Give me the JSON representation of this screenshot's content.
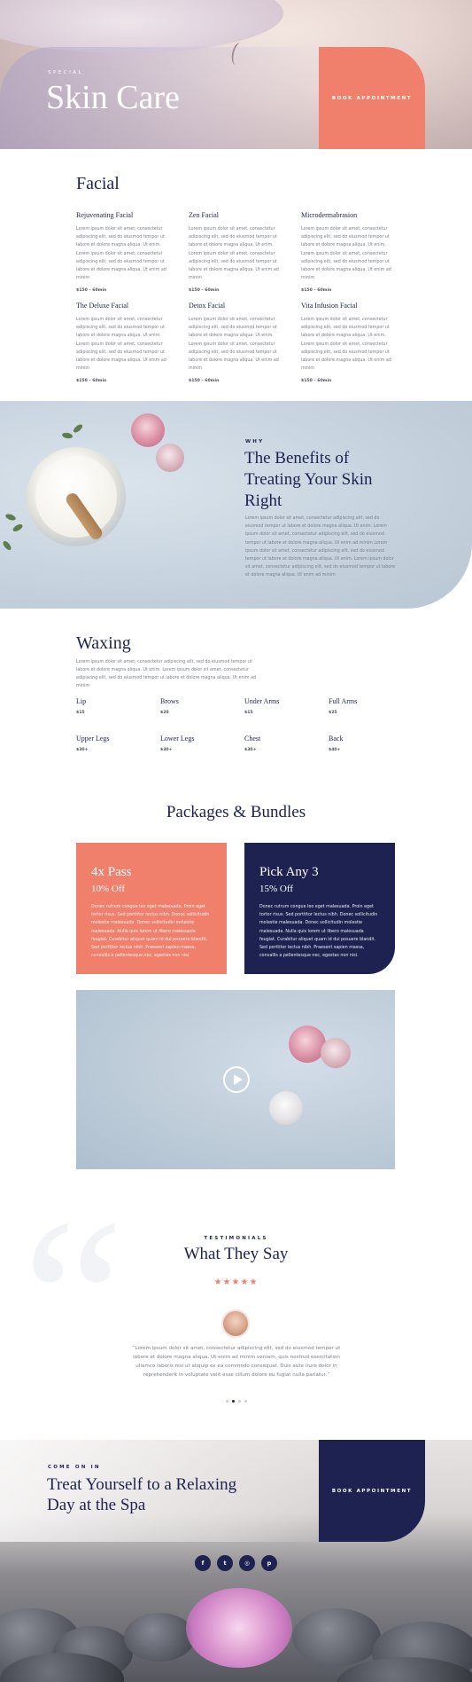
{
  "colors": {
    "navy": "#1d2250",
    "coral": "#f07f6c",
    "text": "#7b7f8a"
  },
  "hero": {
    "eyebrow": "SPECIAL",
    "title": "Skin Care",
    "cta": "BOOK APPOINTMENT"
  },
  "facial": {
    "title": "Facial",
    "services": [
      {
        "name": "Rejuvenating Facial",
        "desc": "Lorem ipsum dolor sit amet, consectetur adipiscing elit, sed do eiusmod tempor ut labore et dolore magna aliqua. Ut enim. Lorem ipsum dolor sit amet, consectetur adipiscing elit, sed do eiusmod tempor ut labore et dolore magna aliqua. Ut enim ad minim",
        "price": "$150 – 60min"
      },
      {
        "name": "Zen Facial",
        "desc": "Lorem ipsum dolor sit amet, consectetur adipiscing elit, sed do eiusmod tempor ut labore et dolore magna aliqua. Ut enim. Lorem ipsum dolor sit amet, consectetur adipiscing elit, sed do eiusmod tempor ut labore et dolore magna aliqua. Ut enim ad minim",
        "price": "$150 – 60min"
      },
      {
        "name": "Microdermabrasion",
        "desc": "Lorem ipsum dolor sit amet, consectetur adipiscing elit, sed do eiusmod tempor ut labore et dolore magna aliqua. Ut enim. Lorem ipsum dolor sit amet, consectetur adipiscing elit, sed do eiusmod tempor ut labore et dolore magna aliqua. Ut enim ad minim",
        "price": "$150 – 60min"
      },
      {
        "name": "The Deluxe Facial",
        "desc": "Lorem ipsum dolor sit amet, consectetur adipiscing elit, sed do eiusmod tempor ut labore et dolore magna aliqua. Ut enim. Lorem ipsum dolor sit amet, consectetur adipiscing elit, sed do eiusmod tempor ut labore et dolore magna aliqua. Ut enim ad minim",
        "price": "$150 – 60min"
      },
      {
        "name": "Detox Facial",
        "desc": "Lorem ipsum dolor sit amet, consectetur adipiscing elit, sed do eiusmod tempor ut labore et dolore magna aliqua. Ut enim. Lorem ipsum dolor sit amet, consectetur adipiscing elit, sed do eiusmod tempor ut labore et dolore magna aliqua. Ut enim ad minim",
        "price": "$150 – 60min"
      },
      {
        "name": "Vita Infusion Facial",
        "desc": "Lorem ipsum dolor sit amet, consectetur adipiscing elit, sed do eiusmod tempor ut labore et dolore magna aliqua. Ut enim. Lorem ipsum dolor sit amet, consectetur adipiscing elit, sed do eiusmod tempor ut labore et dolore magna aliqua. Ut enim ad minim",
        "price": "$150 – 60min"
      }
    ]
  },
  "benefits": {
    "eyebrow": "WHY",
    "title": "The Benefits of Treating Your Skin Right",
    "text": "Lorem ipsum dolor sit amet, consectetur adipiscing elit, sed do eiusmod tempor ut labore et dolore magna aliqua. Ut enim. Lorem ipsum dolor sit amet, consectetur adipiscing elit, sed do eiusmod tempor ut labore et dolore magna aliqua. Ut enim ad minim Lorem ipsum dolor sit amet, consectetur adipiscing elit, sed do eiusmod tempor ut labore et dolore magna aliqua. Ut enim. Lorem ipsum dolor sit amet, consectetur adipiscing elit, sed do eiusmod tempor ut labore et dolore magna aliqua. Ut enim ad minim"
  },
  "waxing": {
    "title": "Waxing",
    "desc": "Lorem ipsum dolor sit amet, consectetur adipiscing elit, sed do eiusmod tempor ut labore et dolore magna aliqua. Ut enim. Lorem ipsum dolor sit amet, consectetur adipiscing elit, sed do eiusmod tempor ut labore et dolore magna aliqua. Ut enim ad minim",
    "items": [
      {
        "name": "Lip",
        "price": "$15"
      },
      {
        "name": "Brows",
        "price": "$20"
      },
      {
        "name": "Under Arms",
        "price": "$15"
      },
      {
        "name": "Full Arms",
        "price": "$25"
      },
      {
        "name": "Upper Legs",
        "price": "$30+"
      },
      {
        "name": "Lower Legs",
        "price": "$30+"
      },
      {
        "name": "Chest",
        "price": "$30+"
      },
      {
        "name": "Back",
        "price": "$40+"
      }
    ]
  },
  "packages": {
    "title": "Packages & Bundles",
    "items": [
      {
        "name": "4x Pass",
        "discount": "10% Off",
        "desc": "Donec rutrum congue leo eget malesuada. Proin eget tortor risus. Sed porttitor lectus nibh. Donec sollicitudin molestie malesuada. Donec sollicitudin molestie malesuada. Nulla quis lorem ut libero malesuada feugiat. Curabitur aliquet quam id dui posuere blandit. Sed porttitor lectus nibh. Praesent sapien massa, convallis a pellentesque nec, egestas non nisi."
      },
      {
        "name": "Pick Any 3",
        "discount": "15% Off",
        "desc": "Donec rutrum congue leo eget malesuada. Proin eget tortor risus. Sed porttitor lectus nibh. Donec sollicitudin molestie malesuada. Donec sollicitudin molestie malesuada. Nulla quis lorem ut libero malesuada feugiat. Curabitur aliquet quam id dui posuere blandit. Sed porttitor lectus nibh. Praesent sapien massa, convallis a pellentesque nec, egestas non nisi."
      }
    ]
  },
  "video": {
    "play_icon": "play-icon"
  },
  "testimonials": {
    "eyebrow": "TESTIMONIALS",
    "title": "What They Say",
    "stars": "★★★★★",
    "rating": 5,
    "quote": "“Lorem ipsum dolor sit amet, consectetur adipiscing elit, sed do eiusmod tempor ut labore et dolore magna aliqua. Ut enim ad minim veniam, quis nostrud exercitation ullamco laboris nisi ut aliquip ex ea commodo consequat. Duis aute irure dolor in reprehenderit in voluptate velit esse cillum dolore eu fugiat nulla pariatur.”",
    "dots": 4,
    "active_dot": 2
  },
  "cta": {
    "eyebrow": "COME ON IN",
    "title": "Treat Yourself to a Relaxing Day at the Spa",
    "button": "BOOK APPOINTMENT"
  },
  "socials": [
    {
      "icon": "facebook-icon",
      "glyph": "f"
    },
    {
      "icon": "twitter-icon",
      "glyph": "t"
    },
    {
      "icon": "instagram-icon",
      "glyph": "◎"
    },
    {
      "icon": "pinterest-icon",
      "glyph": "p"
    }
  ]
}
